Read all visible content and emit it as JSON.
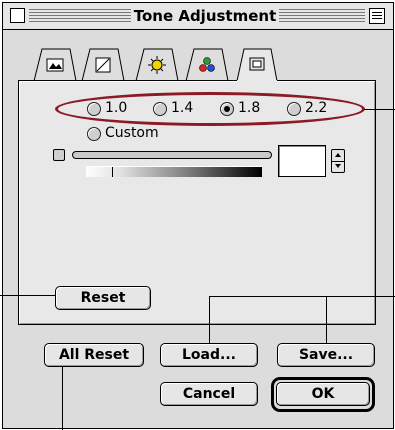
{
  "window": {
    "title": "Tone Adjustment"
  },
  "tabs": [
    {
      "name": "tab-image",
      "icon": "landscape-icon"
    },
    {
      "name": "tab-curve",
      "icon": "curve-icon"
    },
    {
      "name": "tab-brightness",
      "icon": "sun-icon"
    },
    {
      "name": "tab-color",
      "icon": "rgb-dots-icon"
    },
    {
      "name": "tab-gamma",
      "icon": "monitor-icon",
      "selected": true
    }
  ],
  "gamma": {
    "options": [
      "1.0",
      "1.4",
      "1.8",
      "2.2"
    ],
    "selected": "1.8",
    "custom_label": "Custom",
    "value": ""
  },
  "buttons": {
    "reset": "Reset",
    "all_reset": "All Reset",
    "load": "Load...",
    "save": "Save...",
    "cancel": "Cancel",
    "ok": "OK"
  },
  "colors": {
    "highlight": "#8b1a24"
  }
}
